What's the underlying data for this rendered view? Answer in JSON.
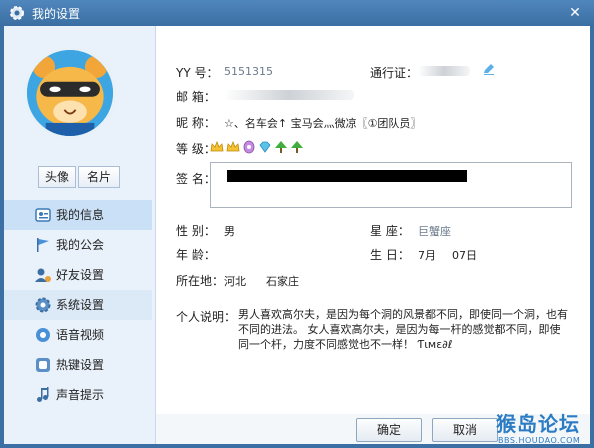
{
  "window": {
    "title": "我的设置",
    "close_glyph": "✕"
  },
  "sidebar": {
    "avatar_button": "头像",
    "card_button": "名片",
    "items": [
      {
        "label": "我的信息",
        "icon": "id-card-icon"
      },
      {
        "label": "我的公会",
        "icon": "flag-icon"
      },
      {
        "label": "好友设置",
        "icon": "friend-gear-icon"
      },
      {
        "label": "系统设置",
        "icon": "gear-icon"
      },
      {
        "label": "语音视频",
        "icon": "speaker-icon"
      },
      {
        "label": "热键设置",
        "icon": "keyboard-icon"
      },
      {
        "label": "声音提示",
        "icon": "music-note-icon"
      }
    ]
  },
  "profile": {
    "yy_label": "YY  号：",
    "yy_value": "5151315",
    "pass_label": "通行证：",
    "email_label": "邮  箱：",
    "nick_label": "昵  称：",
    "nick_value": "☆、名车会↑ 宝马会灬微凉〖①团队员〗",
    "level_label": "等  级：",
    "sign_label": "签  名：",
    "gender_label": "性  别：",
    "gender_value": "男",
    "zodiac_label": "星  座：",
    "zodiac_value": "巨蟹座",
    "age_label": "年  龄：",
    "birthday_label": "生  日：",
    "birthday_month": "7月",
    "birthday_day": "07日",
    "location_label": "所在地：",
    "province": "河北",
    "city": "石家庄",
    "bio_label": "个人说明：",
    "bio_value": "男人喜欢高尔夫，是因为每个洞的风景都不同，即使同一个洞，也有不同的进法。 女人喜欢高尔夫，是因为每一杆的感觉都不同，即使同一个杆，力度不同感觉也不一样！ Ƭιмε∂ℓ"
  },
  "footer": {
    "ok": "确定",
    "cancel": "取消"
  },
  "watermark": {
    "main": "猴岛论坛",
    "sub": "BBS.HOUDAO.COM"
  }
}
